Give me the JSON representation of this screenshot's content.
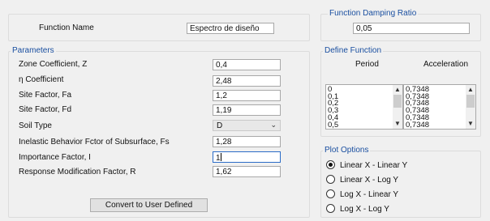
{
  "function_name": {
    "label": "Function Name",
    "value": "Espectro de diseño"
  },
  "damping": {
    "title": "Function Damping Ratio",
    "value": "0,05"
  },
  "parameters": {
    "title": "Parameters",
    "zone_label": "Zone Coefficient, Z",
    "zone_value": "0,4",
    "eta_label": "η Coefficient",
    "eta_value": "2,48",
    "fa_label": "Site Factor, Fa",
    "fa_value": "1,2",
    "fd_label": "Site Factor, Fd",
    "fd_value": "1,19",
    "soil_label": "Soil Type",
    "soil_value": "D",
    "fs_label": "Inelastic Behavior Fctor of Subsurface, Fs",
    "fs_value": "1,28",
    "importance_label": "Importance Factor, I",
    "importance_value": "1",
    "r_label": "Response Modification Factor, R",
    "r_value": "1,62",
    "convert_button": "Convert to User Defined"
  },
  "define_function": {
    "title": "Define Function",
    "period_header": "Period",
    "accel_header": "Acceleration",
    "periods": [
      "0",
      "0,1",
      "0,2",
      "0,3",
      "0,4",
      "0,5"
    ],
    "accelerations": [
      "0,7348",
      "0,7348",
      "0,7348",
      "0,7348",
      "0,7348",
      "0,7348"
    ]
  },
  "plot_options": {
    "title": "Plot Options",
    "options": [
      "Linear X - Linear Y",
      "Linear X - Log Y",
      "Log X - Linear Y",
      "Log X - Log Y"
    ],
    "selected_index": 0
  }
}
